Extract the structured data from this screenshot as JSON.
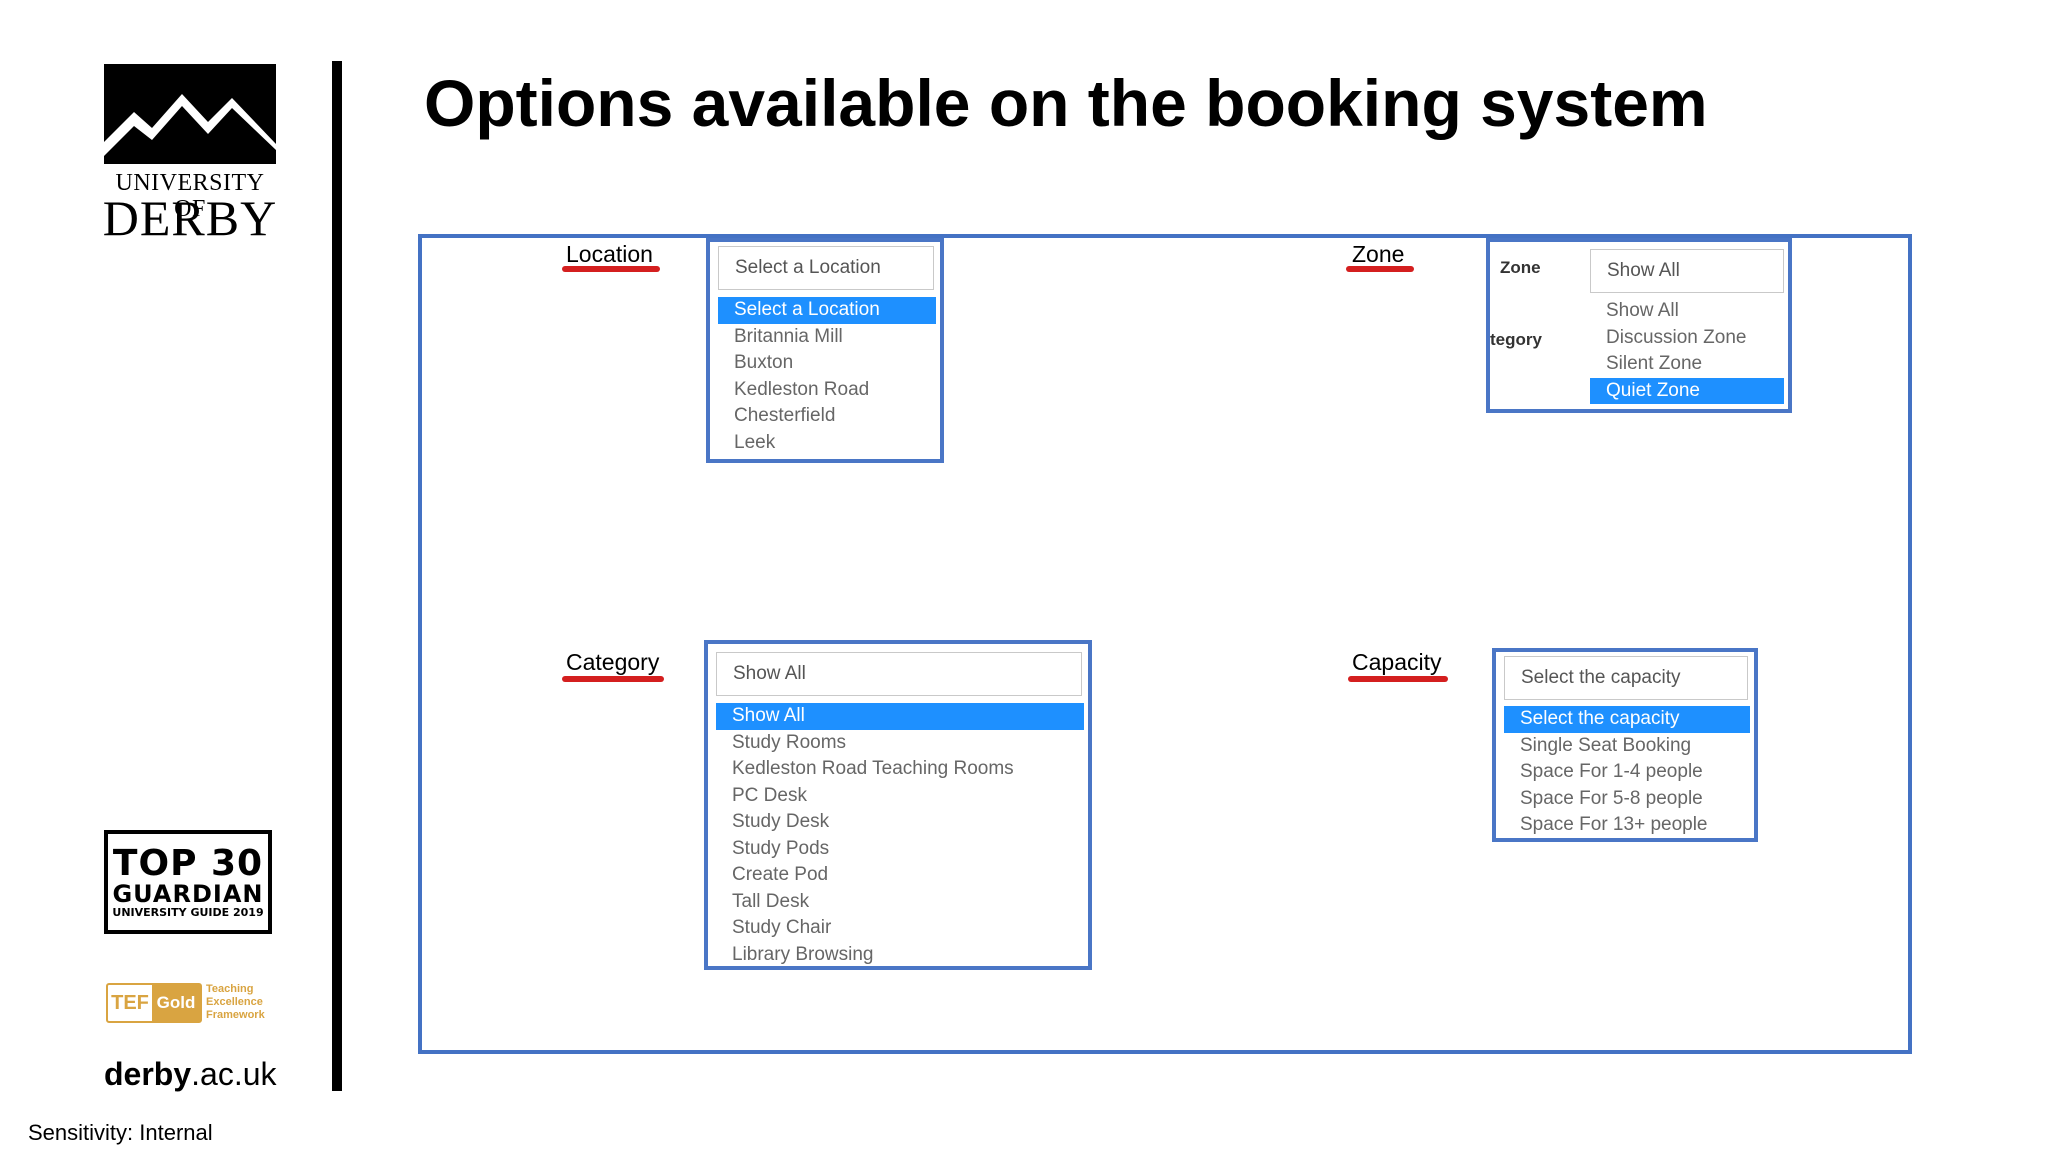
{
  "slide": {
    "title": "Options available on the booking system",
    "sensitivity": "Sensitivity: Internal"
  },
  "branding": {
    "university_line1": "UNIVERSITY OF",
    "university_line2": "DERBY",
    "guardian_top": "TOP 30",
    "guardian_mid": "GUARDIAN",
    "guardian_bot": "UNIVERSITY GUIDE 2019",
    "tef_badge": "TEF",
    "tef_level": "Gold",
    "tef_text_1": "Teaching",
    "tef_text_2": "Excellence",
    "tef_text_3": "Framework",
    "website_bold": "derby",
    "website_rest": ".ac.uk"
  },
  "location": {
    "label": "Location",
    "selected": "Select a Location",
    "options": [
      "Select a Location",
      "Britannia Mill",
      "Buxton",
      "Kedleston Road",
      "Chesterfield",
      "Leek"
    ],
    "active_option": "Select a Location"
  },
  "zone": {
    "label": "Zone",
    "side_label_1": "Zone",
    "side_label_2": "tegory",
    "selected": "Show All",
    "options": [
      "Show All",
      "Discussion Zone",
      "Silent Zone",
      "Quiet Zone"
    ],
    "active_option": "Quiet Zone"
  },
  "category": {
    "label": "Category",
    "selected": "Show All",
    "options": [
      "Show All",
      "Study Rooms",
      "Kedleston Road Teaching Rooms",
      "PC Desk",
      "Study Desk",
      "Study Pods",
      "Create Pod",
      "Tall Desk",
      "Study Chair",
      "Library Browsing"
    ],
    "active_option": "Show All"
  },
  "capacity": {
    "label": "Capacity",
    "selected": "Select the capacity",
    "options": [
      "Select the capacity",
      "Single Seat Booking",
      "Space For 1-4 people",
      "Space For 5-8 people",
      "Space For 13+ people"
    ],
    "active_option": "Select the capacity"
  },
  "colors": {
    "frame_blue": "#4472c4",
    "highlight_blue": "#1e90ff",
    "underline_red": "#d41f1f",
    "tef_gold": "#d9a441"
  }
}
